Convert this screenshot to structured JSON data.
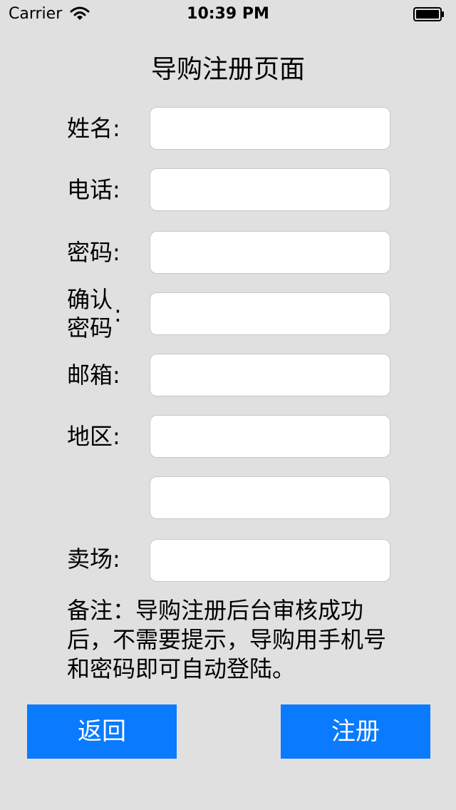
{
  "status_bar": {
    "carrier": "Carrier",
    "time": "10:39 PM"
  },
  "title": "导购注册页面",
  "form": {
    "name_label": "姓名:",
    "phone_label": "电话:",
    "password_label": "密码:",
    "confirm_label_line1": "确认",
    "confirm_label_line2": "密码",
    "confirm_label_colon": ":",
    "email_label": "邮箱:",
    "region_label": "地区:",
    "store_label": "卖场:"
  },
  "note": "备注：导购注册后台审核成功后，不需要提示，导购用手机号和密码即可自动登陆。",
  "buttons": {
    "back": "返回",
    "register": "注册"
  },
  "colors": {
    "background": "#e0e0e0",
    "button": "#0a7afe",
    "button_text": "#ffffff"
  },
  "icons": {
    "wifi": "wifi-icon",
    "battery": "battery-icon"
  }
}
